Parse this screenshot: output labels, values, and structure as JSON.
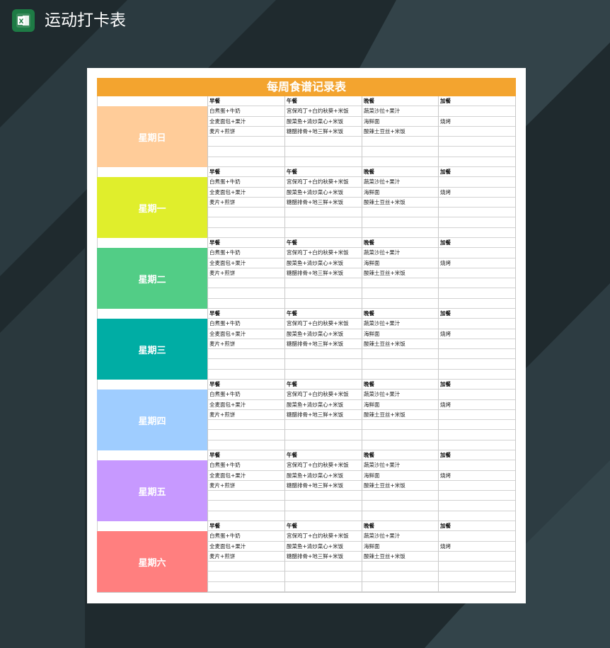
{
  "app": {
    "title": "运动打卡表",
    "icon": "excel-icon",
    "icon_letter": "X"
  },
  "sheet": {
    "title": "每周食谱记录表",
    "title_color": "#f3a42f",
    "meal_headers": [
      "早餐",
      "午餐",
      "晚餐",
      "加餐"
    ],
    "days": [
      {
        "label": "星期日",
        "color": "#ffcc99"
      },
      {
        "label": "星期一",
        "color": "#e0ee2c"
      },
      {
        "label": "星期二",
        "color": "#52cd86"
      },
      {
        "label": "星期三",
        "color": "#00ada4"
      },
      {
        "label": "星期四",
        "color": "#9fcdff"
      },
      {
        "label": "星期五",
        "color": "#c799ff"
      },
      {
        "label": "星期六",
        "color": "#ff7f7f"
      }
    ],
    "meals": [
      [
        "白煮蛋+牛奶",
        "宫保鸡丁+白灼秋葵+米饭",
        "蔬菜沙拉+果汁",
        ""
      ],
      [
        "全麦面包+果汁",
        "酸菜鱼+清炒菜心+米饭",
        "海鲜面",
        "烧烤"
      ],
      [
        "麦片+煎饼",
        "糖醋排骨+地三鲜+米饭",
        "酸辣土豆丝+米饭",
        ""
      ]
    ]
  }
}
